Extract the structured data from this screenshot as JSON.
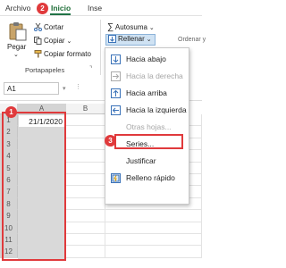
{
  "tabs": {
    "archivo": "Archivo",
    "inicio": "Inicio",
    "insertar": "Inse"
  },
  "steps": {
    "one": "1",
    "two": "2",
    "three": "3"
  },
  "clipboard": {
    "paste_label": "Pegar",
    "cut_label": "Cortar",
    "copy_label": "Copiar",
    "format_painter_label": "Copiar formato",
    "group_label": "Portapapeles"
  },
  "editing": {
    "autosum_label": "Autosuma",
    "fill_label": "Rellenar",
    "sort_partial": "Ordenar y"
  },
  "namebox": {
    "value": "A1"
  },
  "columns": [
    "A",
    "B"
  ],
  "rows": [
    "1",
    "2",
    "3",
    "4",
    "5",
    "6",
    "7",
    "8",
    "9",
    "10",
    "11",
    "12"
  ],
  "cell_a1": "21/1/2020",
  "menu": {
    "items": [
      {
        "label": "Hacia abajo",
        "enabled": true
      },
      {
        "label": "Hacia la derecha",
        "enabled": false
      },
      {
        "label": "Hacia arriba",
        "enabled": true
      },
      {
        "label": "Hacia la izquierda",
        "enabled": true
      },
      {
        "label": "Otras hojas...",
        "enabled": false
      },
      {
        "label": "Series...",
        "enabled": true
      },
      {
        "label": "Justificar",
        "enabled": true
      },
      {
        "label": "Relleno rápido",
        "enabled": true
      }
    ]
  },
  "colors": {
    "accent": "#217346",
    "marker": "#e03a3c",
    "selection": "#d9d9d9"
  }
}
